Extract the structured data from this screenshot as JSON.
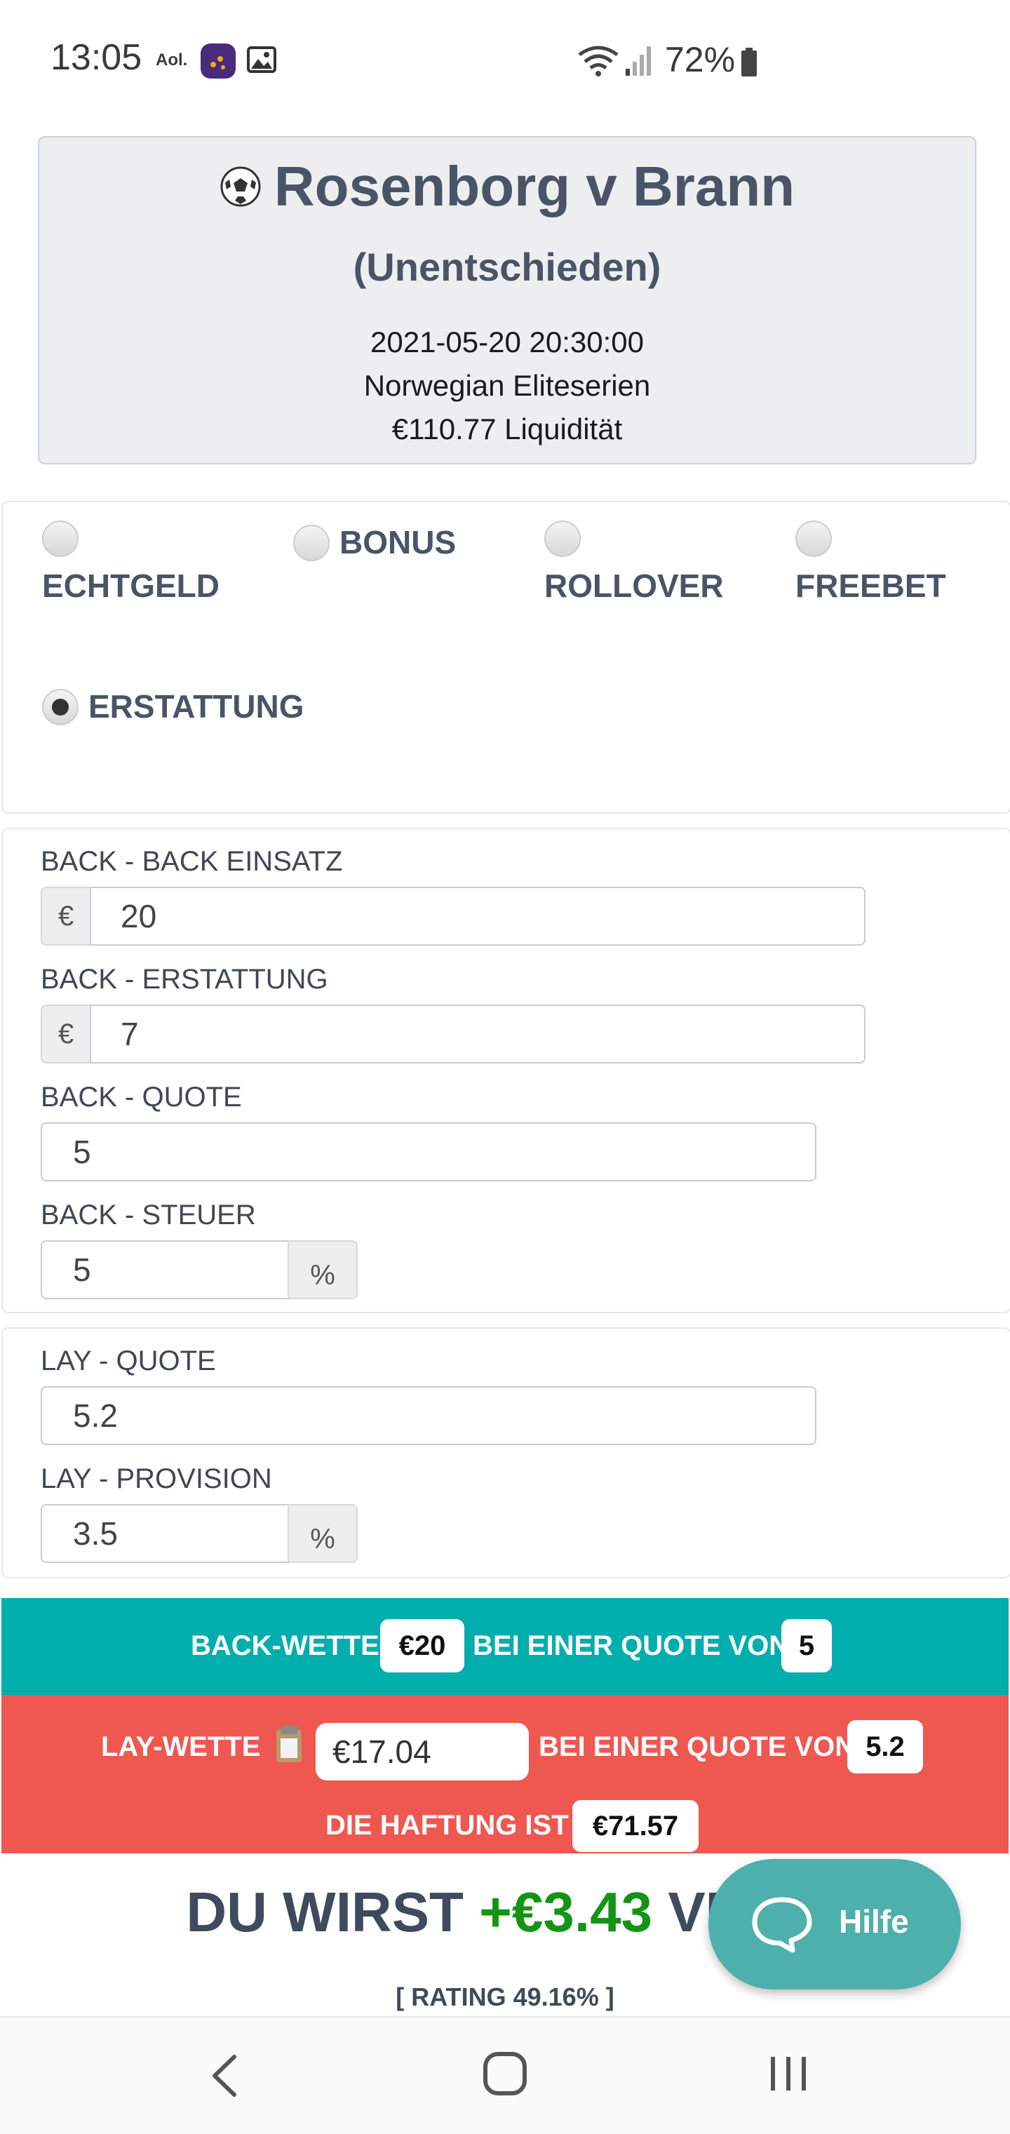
{
  "status_bar": {
    "time": "13:05",
    "aol_label": "Aol.",
    "battery_percent": "72%",
    "icons": [
      "app-icon",
      "gallery-icon",
      "wifi-icon",
      "signal-icon",
      "battery-icon"
    ]
  },
  "event": {
    "title": "Rosenborg v Brann",
    "selection": "(Unentschieden)",
    "datetime": "2021-05-20 20:30:00",
    "competition": "Norwegian Eliteserien",
    "liquidity": "€110.77 Liquidität",
    "icon": "soccer-ball-icon"
  },
  "bet_types": [
    {
      "label": "ECHTGELD",
      "checked": false
    },
    {
      "label": "BONUS",
      "checked": false
    },
    {
      "label": "ROLLOVER",
      "checked": false
    },
    {
      "label": "FREEBET",
      "checked": false
    },
    {
      "label": "ERSTATTUNG",
      "checked": true
    }
  ],
  "back_form": {
    "stake_label": "BACK - BACK EINSATZ",
    "stake_currency": "€",
    "stake_value": "20",
    "refund_label": "BACK - ERSTATTUNG",
    "refund_currency": "€",
    "refund_value": "7",
    "odds_label": "BACK - QUOTE",
    "odds_value": "5",
    "tax_label": "BACK - STEUER",
    "tax_value": "5",
    "tax_unit": "%"
  },
  "lay_form": {
    "odds_label": "LAY - QUOTE",
    "odds_value": "5.2",
    "commission_label": "LAY - PROVISION",
    "commission_value": "3.5",
    "commission_unit": "%"
  },
  "back_bet": {
    "prefix": "BACK-WETTE",
    "amount": "€20",
    "middle": "BEI EINER QUOTE VON",
    "odds": "5",
    "color": "#00aeae"
  },
  "lay_bet": {
    "prefix": "LAY-WETTE",
    "amount": "€17.04",
    "middle": "BEI EINER QUOTE VON",
    "odds": "5.2",
    "liability_label": "DIE HAFTUNG IST",
    "liability": "€71.57",
    "copy_icon": "clipboard-icon",
    "color": "#ef5751"
  },
  "result": {
    "prefix": "DU WIRST",
    "amount": "+€3.43",
    "suffix": "VERD",
    "rating": "[ RATING 49.16% ]",
    "amount_color": "#149414"
  },
  "help": {
    "label": "Hilfe",
    "icon": "chat-bubble-icon",
    "color": "#4db0ac"
  },
  "nav_bar": {
    "icons": [
      "back-icon",
      "home-icon",
      "recents-icon"
    ]
  }
}
